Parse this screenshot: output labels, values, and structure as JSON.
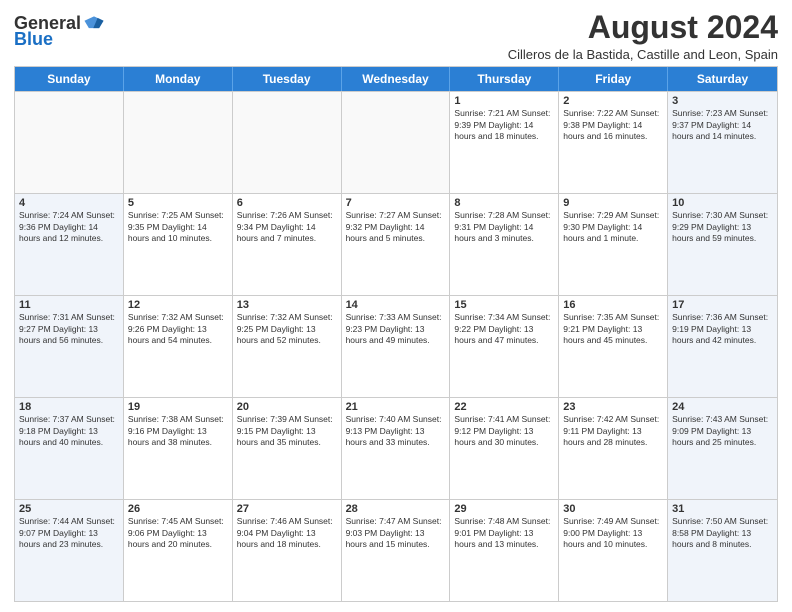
{
  "header": {
    "logo_general": "General",
    "logo_blue": "Blue",
    "main_title": "August 2024",
    "subtitle": "Cilleros de la Bastida, Castille and Leon, Spain"
  },
  "calendar": {
    "days_of_week": [
      "Sunday",
      "Monday",
      "Tuesday",
      "Wednesday",
      "Thursday",
      "Friday",
      "Saturday"
    ],
    "rows": [
      [
        {
          "day": "",
          "info": "",
          "empty": true
        },
        {
          "day": "",
          "info": "",
          "empty": true
        },
        {
          "day": "",
          "info": "",
          "empty": true
        },
        {
          "day": "",
          "info": "",
          "empty": true
        },
        {
          "day": "1",
          "info": "Sunrise: 7:21 AM\nSunset: 9:39 PM\nDaylight: 14 hours\nand 18 minutes."
        },
        {
          "day": "2",
          "info": "Sunrise: 7:22 AM\nSunset: 9:38 PM\nDaylight: 14 hours\nand 16 minutes."
        },
        {
          "day": "3",
          "info": "Sunrise: 7:23 AM\nSunset: 9:37 PM\nDaylight: 14 hours\nand 14 minutes."
        }
      ],
      [
        {
          "day": "4",
          "info": "Sunrise: 7:24 AM\nSunset: 9:36 PM\nDaylight: 14 hours\nand 12 minutes."
        },
        {
          "day": "5",
          "info": "Sunrise: 7:25 AM\nSunset: 9:35 PM\nDaylight: 14 hours\nand 10 minutes."
        },
        {
          "day": "6",
          "info": "Sunrise: 7:26 AM\nSunset: 9:34 PM\nDaylight: 14 hours\nand 7 minutes."
        },
        {
          "day": "7",
          "info": "Sunrise: 7:27 AM\nSunset: 9:32 PM\nDaylight: 14 hours\nand 5 minutes."
        },
        {
          "day": "8",
          "info": "Sunrise: 7:28 AM\nSunset: 9:31 PM\nDaylight: 14 hours\nand 3 minutes."
        },
        {
          "day": "9",
          "info": "Sunrise: 7:29 AM\nSunset: 9:30 PM\nDaylight: 14 hours\nand 1 minute."
        },
        {
          "day": "10",
          "info": "Sunrise: 7:30 AM\nSunset: 9:29 PM\nDaylight: 13 hours\nand 59 minutes."
        }
      ],
      [
        {
          "day": "11",
          "info": "Sunrise: 7:31 AM\nSunset: 9:27 PM\nDaylight: 13 hours\nand 56 minutes."
        },
        {
          "day": "12",
          "info": "Sunrise: 7:32 AM\nSunset: 9:26 PM\nDaylight: 13 hours\nand 54 minutes."
        },
        {
          "day": "13",
          "info": "Sunrise: 7:32 AM\nSunset: 9:25 PM\nDaylight: 13 hours\nand 52 minutes."
        },
        {
          "day": "14",
          "info": "Sunrise: 7:33 AM\nSunset: 9:23 PM\nDaylight: 13 hours\nand 49 minutes."
        },
        {
          "day": "15",
          "info": "Sunrise: 7:34 AM\nSunset: 9:22 PM\nDaylight: 13 hours\nand 47 minutes."
        },
        {
          "day": "16",
          "info": "Sunrise: 7:35 AM\nSunset: 9:21 PM\nDaylight: 13 hours\nand 45 minutes."
        },
        {
          "day": "17",
          "info": "Sunrise: 7:36 AM\nSunset: 9:19 PM\nDaylight: 13 hours\nand 42 minutes."
        }
      ],
      [
        {
          "day": "18",
          "info": "Sunrise: 7:37 AM\nSunset: 9:18 PM\nDaylight: 13 hours\nand 40 minutes."
        },
        {
          "day": "19",
          "info": "Sunrise: 7:38 AM\nSunset: 9:16 PM\nDaylight: 13 hours\nand 38 minutes."
        },
        {
          "day": "20",
          "info": "Sunrise: 7:39 AM\nSunset: 9:15 PM\nDaylight: 13 hours\nand 35 minutes."
        },
        {
          "day": "21",
          "info": "Sunrise: 7:40 AM\nSunset: 9:13 PM\nDaylight: 13 hours\nand 33 minutes."
        },
        {
          "day": "22",
          "info": "Sunrise: 7:41 AM\nSunset: 9:12 PM\nDaylight: 13 hours\nand 30 minutes."
        },
        {
          "day": "23",
          "info": "Sunrise: 7:42 AM\nSunset: 9:11 PM\nDaylight: 13 hours\nand 28 minutes."
        },
        {
          "day": "24",
          "info": "Sunrise: 7:43 AM\nSunset: 9:09 PM\nDaylight: 13 hours\nand 25 minutes."
        }
      ],
      [
        {
          "day": "25",
          "info": "Sunrise: 7:44 AM\nSunset: 9:07 PM\nDaylight: 13 hours\nand 23 minutes."
        },
        {
          "day": "26",
          "info": "Sunrise: 7:45 AM\nSunset: 9:06 PM\nDaylight: 13 hours\nand 20 minutes."
        },
        {
          "day": "27",
          "info": "Sunrise: 7:46 AM\nSunset: 9:04 PM\nDaylight: 13 hours\nand 18 minutes."
        },
        {
          "day": "28",
          "info": "Sunrise: 7:47 AM\nSunset: 9:03 PM\nDaylight: 13 hours\nand 15 minutes."
        },
        {
          "day": "29",
          "info": "Sunrise: 7:48 AM\nSunset: 9:01 PM\nDaylight: 13 hours\nand 13 minutes."
        },
        {
          "day": "30",
          "info": "Sunrise: 7:49 AM\nSunset: 9:00 PM\nDaylight: 13 hours\nand 10 minutes."
        },
        {
          "day": "31",
          "info": "Sunrise: 7:50 AM\nSunset: 8:58 PM\nDaylight: 13 hours\nand 8 minutes."
        }
      ]
    ]
  }
}
